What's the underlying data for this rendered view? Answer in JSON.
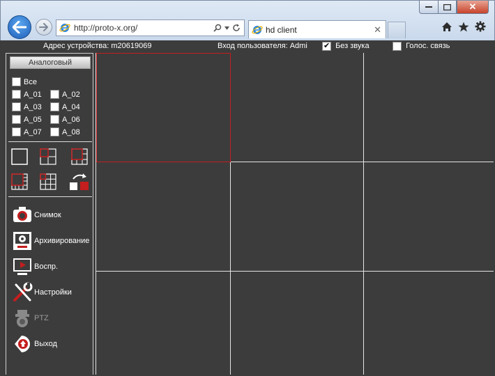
{
  "browser": {
    "address": "http://proto-x.org/",
    "tab_title": "hd client",
    "icons": [
      "back-arrow-icon",
      "forward-arrow-icon",
      "ie-logo-icon",
      "search-icon",
      "refresh-icon",
      "home-icon",
      "favorites-star-icon",
      "settings-gear-icon"
    ]
  },
  "header": {
    "device_address": "Адрес устройства: m20619069",
    "user_login": "Вход пользователя: Admi",
    "mute_label": "Без звука",
    "mute_checked": true,
    "voice_label": "Голос. связь",
    "voice_checked": false
  },
  "sidebar": {
    "group_button": "Аналоговый",
    "all_label": "Все",
    "channels": [
      "A_01",
      "A_02",
      "A_03",
      "A_04",
      "A_05",
      "A_06",
      "A_07",
      "A_08"
    ],
    "layouts": [
      "layout-1-icon",
      "layout-4-icon",
      "layout-6-icon",
      "layout-8-icon",
      "layout-9-icon",
      "layout-switch-icon"
    ],
    "menu": [
      {
        "label": "Снимок",
        "icon": "camera-snapshot-icon",
        "enabled": true
      },
      {
        "label": "Архивирование",
        "icon": "record-icon",
        "enabled": true
      },
      {
        "label": "Воспр.",
        "icon": "playback-icon",
        "enabled": true
      },
      {
        "label": "Настройки",
        "icon": "settings-tools-icon",
        "enabled": true
      },
      {
        "label": "PTZ",
        "icon": "ptz-camera-icon",
        "enabled": false
      },
      {
        "label": "Выход",
        "icon": "exit-icon",
        "enabled": true
      }
    ]
  },
  "colors": {
    "background": "#3c3c3c",
    "accent_red": "#c41e1e",
    "grid_lines": "#e6e6e6"
  }
}
